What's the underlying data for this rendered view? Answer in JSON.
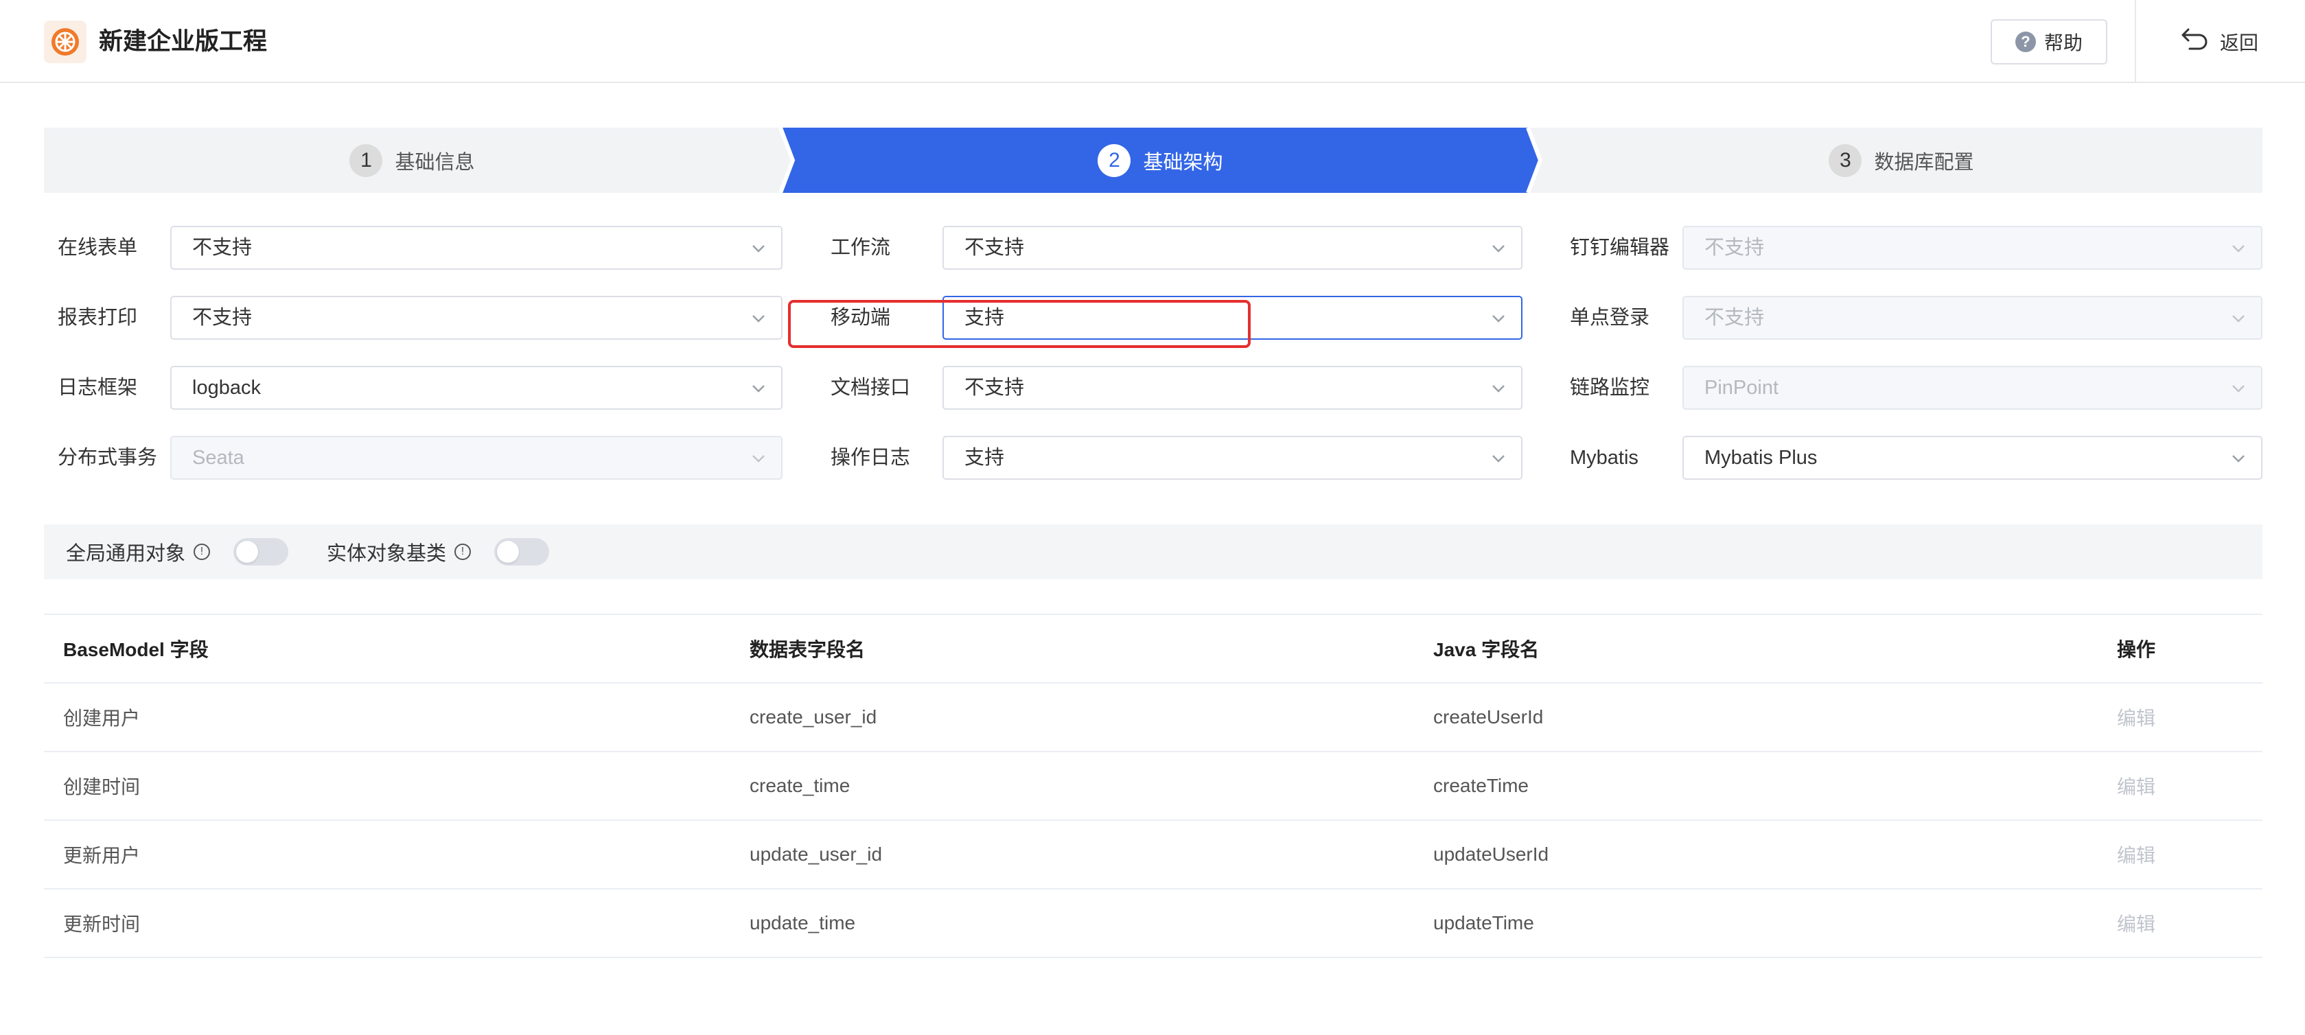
{
  "header": {
    "title": "新建企业版工程",
    "help_label": "帮助",
    "back_label": "返回"
  },
  "steps": [
    {
      "num": "1",
      "label": "基础信息",
      "state": "inactive"
    },
    {
      "num": "2",
      "label": "基础架构",
      "state": "active"
    },
    {
      "num": "3",
      "label": "数据库配置",
      "state": "inactive"
    }
  ],
  "form": {
    "online_form": {
      "label": "在线表单",
      "value": "不支持"
    },
    "report_print": {
      "label": "报表打印",
      "value": "不支持"
    },
    "log_framework": {
      "label": "日志框架",
      "value": "logback"
    },
    "distributed_tx": {
      "label": "分布式事务",
      "value": "Seata"
    },
    "workflow": {
      "label": "工作流",
      "value": "不支持"
    },
    "mobile": {
      "label": "移动端",
      "value": "支持"
    },
    "doc_api": {
      "label": "文档接口",
      "value": "不支持"
    },
    "op_log": {
      "label": "操作日志",
      "value": "支持"
    },
    "dingtalk_editor": {
      "label": "钉钉编辑器",
      "value": "不支持"
    },
    "sso": {
      "label": "单点登录",
      "value": "不支持"
    },
    "tracing": {
      "label": "链路监控",
      "value": "PinPoint"
    },
    "mybatis": {
      "label": "Mybatis",
      "value": "Mybatis Plus"
    }
  },
  "toggles": {
    "global_object": {
      "label": "全局通用对象",
      "on": false
    },
    "entity_base": {
      "label": "实体对象基类",
      "on": false
    }
  },
  "table": {
    "headers": [
      "BaseModel 字段",
      "数据表字段名",
      "Java 字段名",
      "操作"
    ],
    "rows": [
      [
        "创建用户",
        "create_user_id",
        "createUserId",
        "编辑"
      ],
      [
        "创建时间",
        "create_time",
        "createTime",
        "编辑"
      ],
      [
        "更新用户",
        "update_user_id",
        "updateUserId",
        "编辑"
      ],
      [
        "更新时间",
        "update_time",
        "updateTime",
        "编辑"
      ]
    ]
  },
  "colors": {
    "primary": "#3366e6",
    "highlight": "#e52e2e",
    "logo": "#f07a2a"
  }
}
